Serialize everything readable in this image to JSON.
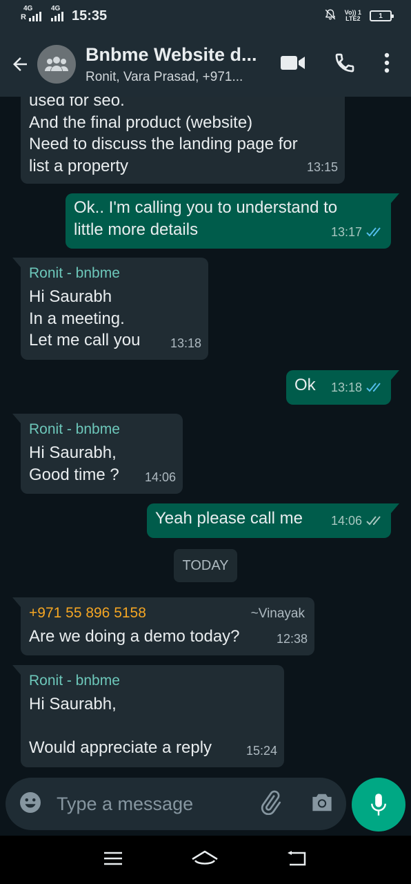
{
  "status_bar": {
    "time": "15:35",
    "network_1": "4G",
    "network_1_prefix": "R",
    "network_2": "4G",
    "volte_top": "Vo)) 1",
    "volte_bottom": "LTE2",
    "battery": "1"
  },
  "header": {
    "title": "Bnbme Website d...",
    "subtitle": "Ronit, Vara Prasad, +971..."
  },
  "messages": [
    {
      "lines": [
        "used for seo.",
        "And the final product (website)",
        "Need to discuss the landing page for",
        "list a property"
      ],
      "time": "13:15"
    },
    {
      "lines": [
        "Ok.. I'm calling you to understand to",
        "little more details"
      ],
      "time": "13:17"
    },
    {
      "sender": "Ronit - bnbme",
      "lines": [
        "Hi Saurabh",
        "In a meeting.",
        "Let me call you"
      ],
      "time": "13:18"
    },
    {
      "lines": [
        "Ok"
      ],
      "time": "13:18"
    },
    {
      "sender": "Ronit - bnbme",
      "lines": [
        "Hi Saurabh,",
        "Good time ?"
      ],
      "time": "14:06"
    },
    {
      "lines": [
        "Yeah please call me"
      ],
      "time": "14:06"
    },
    {
      "sender": "+971 55 896 5158",
      "pushname": "~Vinayak",
      "lines": [
        "Are we doing a demo today?"
      ],
      "time": "12:38"
    },
    {
      "sender": "Ronit - bnbme",
      "lines": [
        "Hi Saurabh,",
        "",
        "Would appreciate a reply"
      ],
      "time": "15:24"
    }
  ],
  "date_separator": "TODAY",
  "composer": {
    "placeholder": "Type a message"
  },
  "colors": {
    "incoming_bubble": "#202c33",
    "outgoing_bubble": "#005c4b",
    "sender_teal": "#6dc7ba",
    "sender_orange": "#f5a623",
    "read_tick": "#53bdeb",
    "accent": "#00a884"
  },
  "icons": {
    "back": "arrow-left-icon",
    "avatar": "group-icon",
    "video": "video-call-icon",
    "call": "phone-icon",
    "menu": "more-vert-icon",
    "emoji": "emoji-icon",
    "attach": "paperclip-icon",
    "camera": "camera-icon",
    "mic": "mic-icon"
  }
}
